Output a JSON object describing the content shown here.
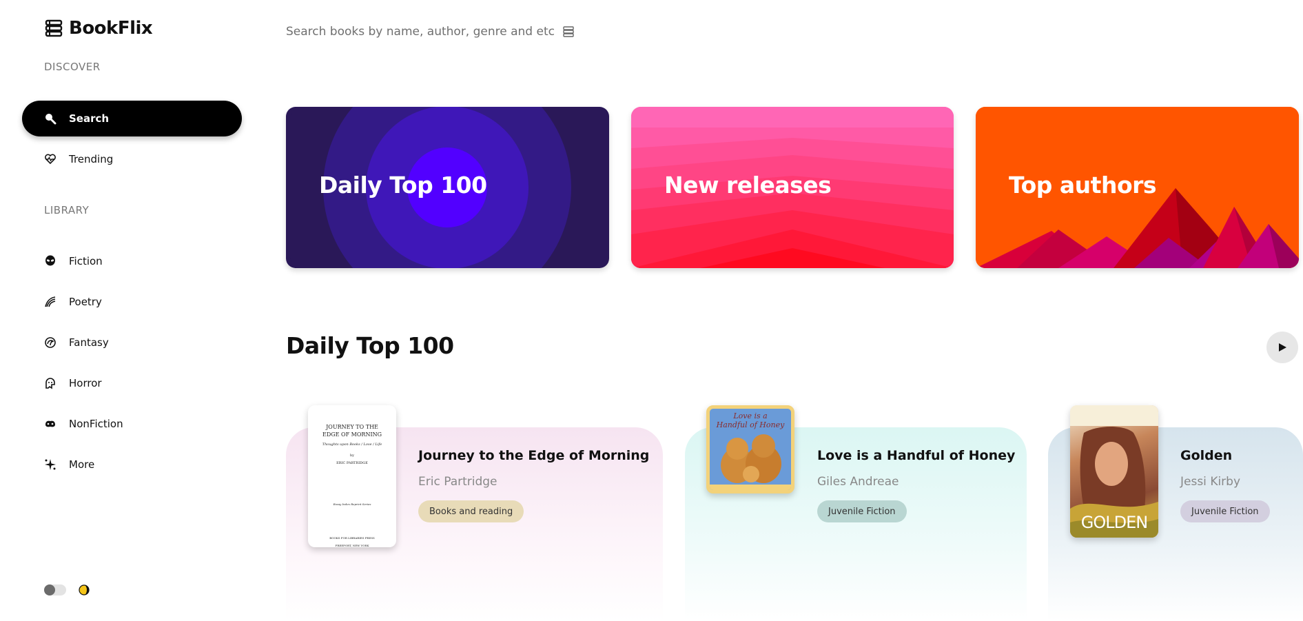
{
  "app": {
    "name": "BookFlix"
  },
  "sidebar": {
    "discover_label": "DISCOVER",
    "library_label": "LIBRARY",
    "discover_items": [
      {
        "label": "Search",
        "icon": "search-icon",
        "active": true
      },
      {
        "label": "Trending",
        "icon": "heart-pulse-icon",
        "active": false
      }
    ],
    "library_items": [
      {
        "label": "Fiction",
        "icon": "alien-icon"
      },
      {
        "label": "Poetry",
        "icon": "feather-icon"
      },
      {
        "label": "Fantasy",
        "icon": "dragon-icon"
      },
      {
        "label": "Horror",
        "icon": "ghost-icon"
      },
      {
        "label": "NonFiction",
        "icon": "brain-icon"
      },
      {
        "label": "More",
        "icon": "sparkles-icon"
      }
    ],
    "theme": {
      "toggle_icon": "toggle-icon",
      "mode_icon": "moon-icon"
    }
  },
  "search": {
    "placeholder": "Search books by name, author, genre and etc ...",
    "icon": "book-stack-icon"
  },
  "hero_cards": [
    {
      "title": "Daily Top 100",
      "color": "#2b1a5e"
    },
    {
      "title": "New releases",
      "color": "#ff3d8e"
    },
    {
      "title": "Top authors",
      "color": "#ff5a00"
    }
  ],
  "daily_top": {
    "title": "Daily Top 100",
    "books": [
      {
        "title": "Journey to the Edge of Morning",
        "author": "Eric Partridge",
        "genre": "Books and reading",
        "card_color": "#f6e6f2",
        "genre_color": "#e8dab9",
        "cover": {
          "line1": "JOURNEY TO THE",
          "line2": "EDGE OF MORNING",
          "sub": "Thoughts upon Books / Love / Life",
          "by": "by",
          "author": "ERIC PARTRIDGE",
          "note": "Essay Index Reprint Series",
          "publisher": "BOOKS FOR LIBRARIES PRESS",
          "place": "FREEPORT, NEW YORK"
        }
      },
      {
        "title": "Love is a Handful of Honey",
        "author": "Giles Andreae",
        "genre": "Juvenile Fiction",
        "card_color": "#dcf6f4",
        "genre_color": "#b9d8d3",
        "cover": {
          "line1": "Love is a",
          "line2": "Handful of Honey"
        }
      },
      {
        "title": "Golden",
        "author": "Jessi Kirby",
        "genre": "Juvenile Fiction",
        "card_color": "#d9e6ee",
        "genre_color": "#d3cfdf",
        "cover": {
          "title": "GOLDEN"
        }
      }
    ]
  }
}
